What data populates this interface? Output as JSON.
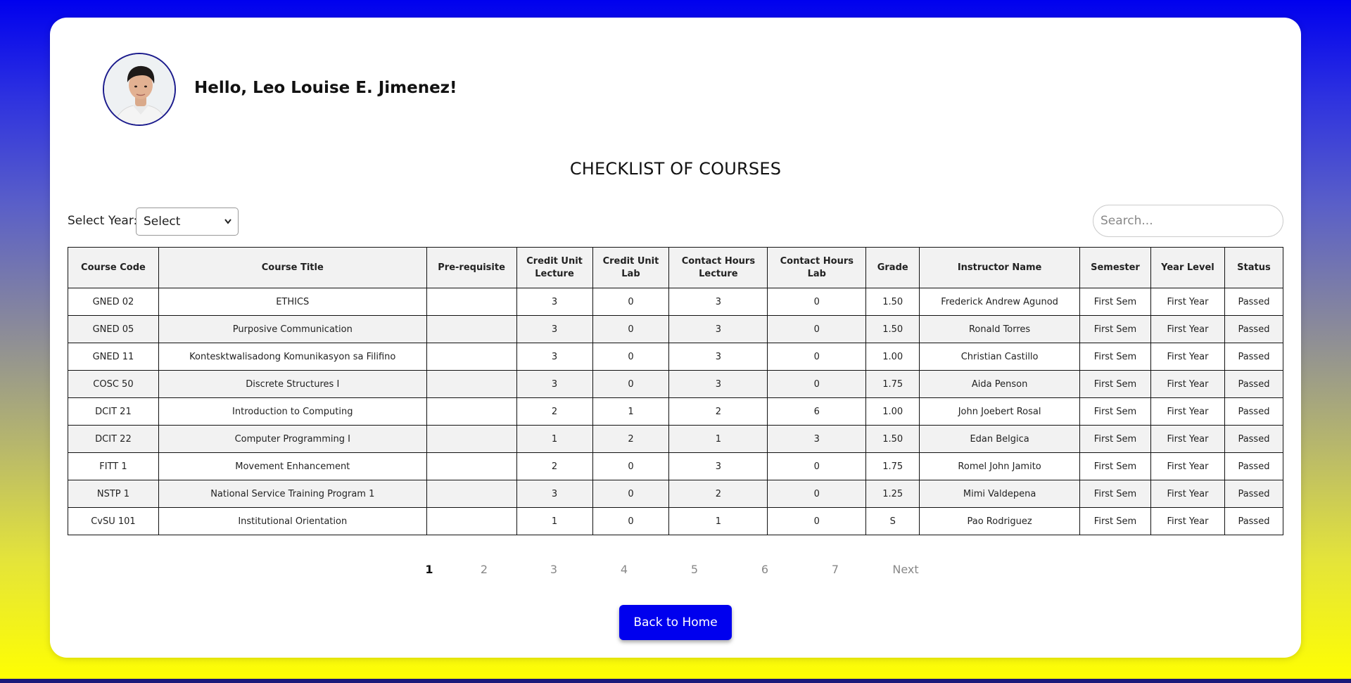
{
  "user": {
    "greeting": "Hello, Leo Louise E. Jimenez!"
  },
  "page_title": "CHECKLIST OF COURSES",
  "filters": {
    "year_label": "Select Year:",
    "year_selected": "Select",
    "search_placeholder": "Search..."
  },
  "table": {
    "headers": {
      "course_code": "Course Code",
      "course_title": "Course Title",
      "prerequisite": "Pre-requisite",
      "credit_lecture_1": "Credit Unit",
      "credit_lecture_2": "Lecture",
      "credit_lab_1": "Credit Unit",
      "credit_lab_2": "Lab",
      "contact_lecture_1": "Contact Hours",
      "contact_lecture_2": "Lecture",
      "contact_lab_1": "Contact Hours",
      "contact_lab_2": "Lab",
      "grade": "Grade",
      "instructor": "Instructor Name",
      "semester": "Semester",
      "year_level": "Year Level",
      "status": "Status"
    },
    "rows": [
      {
        "code": "GNED 02",
        "title": "ETHICS",
        "prereq": "",
        "cu_lec": "3",
        "cu_lab": "0",
        "ch_lec": "3",
        "ch_lab": "0",
        "grade": "1.50",
        "instructor": "Frederick Andrew Agunod",
        "sem": "First Sem",
        "year": "First Year",
        "status": "Passed"
      },
      {
        "code": "GNED 05",
        "title": "Purposive Communication",
        "prereq": "",
        "cu_lec": "3",
        "cu_lab": "0",
        "ch_lec": "3",
        "ch_lab": "0",
        "grade": "1.50",
        "instructor": "Ronald Torres",
        "sem": "First Sem",
        "year": "First Year",
        "status": "Passed"
      },
      {
        "code": "GNED 11",
        "title": "Kontesktwalisadong Komunikasyon sa Filifino",
        "prereq": "",
        "cu_lec": "3",
        "cu_lab": "0",
        "ch_lec": "3",
        "ch_lab": "0",
        "grade": "1.00",
        "instructor": "Christian Castillo",
        "sem": "First Sem",
        "year": "First Year",
        "status": "Passed"
      },
      {
        "code": "COSC 50",
        "title": "Discrete Structures I",
        "prereq": "",
        "cu_lec": "3",
        "cu_lab": "0",
        "ch_lec": "3",
        "ch_lab": "0",
        "grade": "1.75",
        "instructor": "Aida Penson",
        "sem": "First Sem",
        "year": "First Year",
        "status": "Passed"
      },
      {
        "code": "DCIT 21",
        "title": "Introduction to Computing",
        "prereq": "",
        "cu_lec": "2",
        "cu_lab": "1",
        "ch_lec": "2",
        "ch_lab": "6",
        "grade": "1.00",
        "instructor": "John Joebert Rosal",
        "sem": "First Sem",
        "year": "First Year",
        "status": "Passed"
      },
      {
        "code": "DCIT 22",
        "title": "Computer Programming I",
        "prereq": "",
        "cu_lec": "1",
        "cu_lab": "2",
        "ch_lec": "1",
        "ch_lab": "3",
        "grade": "1.50",
        "instructor": "Edan Belgica",
        "sem": "First Sem",
        "year": "First Year",
        "status": "Passed"
      },
      {
        "code": "FITT 1",
        "title": "Movement Enhancement",
        "prereq": "",
        "cu_lec": "2",
        "cu_lab": "0",
        "ch_lec": "3",
        "ch_lab": "0",
        "grade": "1.75",
        "instructor": "Romel John Jamito",
        "sem": "First Sem",
        "year": "First Year",
        "status": "Passed"
      },
      {
        "code": "NSTP 1",
        "title": "National Service Training Program 1",
        "prereq": "",
        "cu_lec": "3",
        "cu_lab": "0",
        "ch_lec": "2",
        "ch_lab": "0",
        "grade": "1.25",
        "instructor": "Mimi Valdepena",
        "sem": "First Sem",
        "year": "First Year",
        "status": "Passed"
      },
      {
        "code": "CvSU 101",
        "title": "Institutional Orientation",
        "prereq": "",
        "cu_lec": "1",
        "cu_lab": "0",
        "ch_lec": "1",
        "ch_lab": "0",
        "grade": "S",
        "instructor": "Pao Rodriguez",
        "sem": "First Sem",
        "year": "First Year",
        "status": "Passed"
      }
    ]
  },
  "pagination": {
    "pages": [
      "1",
      "2",
      "3",
      "4",
      "5",
      "6",
      "7"
    ],
    "next": "Next",
    "current": "1"
  },
  "back_button": "Back to Home",
  "colors": {
    "primary": "#0000ee",
    "gradient_top": "#0000ee",
    "gradient_bottom": "#ffff00",
    "avatar_border": "#1a1a8c"
  },
  "icons": {
    "select_chevron": "chevron-down-icon",
    "avatar": "user-avatar-photo"
  }
}
